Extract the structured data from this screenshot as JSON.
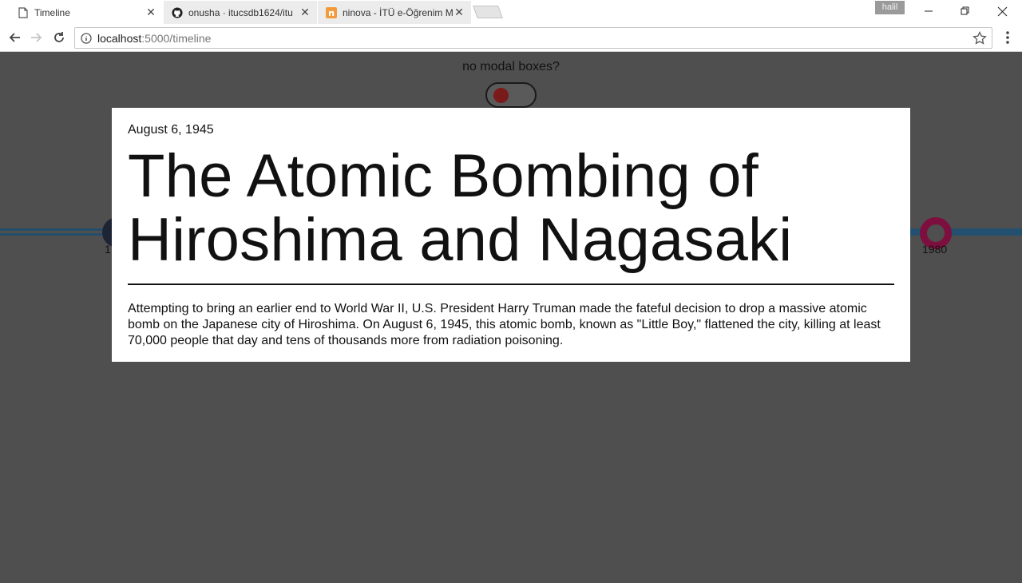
{
  "browser": {
    "tabs": [
      {
        "title": "Timeline",
        "active": true,
        "favicon": "page-icon"
      },
      {
        "title": "onusha · itucsdb1624/itu",
        "active": false,
        "favicon": "github-icon"
      },
      {
        "title": "ninova - İTÜ e-Öğrenim M",
        "active": false,
        "favicon": "ninova-icon"
      }
    ],
    "profile_badge": "halil",
    "url_host": "localhost",
    "url_path": ":5000/timeline"
  },
  "page": {
    "toggle_label": "no modal boxes?",
    "timeline_left_label": "1",
    "timeline_right_label": "1980"
  },
  "modal": {
    "date": "August 6, 1945",
    "title": "The Atomic Bombing of Hiroshima and Nagasaki",
    "body": "Attempting to bring an earlier end to World War II, U.S. President Harry Truman made the fateful decision to drop a massive atomic bomb on the Japanese city of Hiroshima. On August 6, 1945, this atomic bomb, known as \"Little Boy,\" flattened the city, killing at least 70,000 people that day and tens of thousands more from radiation poisoning."
  },
  "colors": {
    "page_background": "#4f4f4f",
    "timeline_line": "#244d6c",
    "timeline_node_dark": "#1d2433",
    "timeline_node_accent": "#7d0f3e",
    "toggle_knob": "#7b1a1a"
  }
}
